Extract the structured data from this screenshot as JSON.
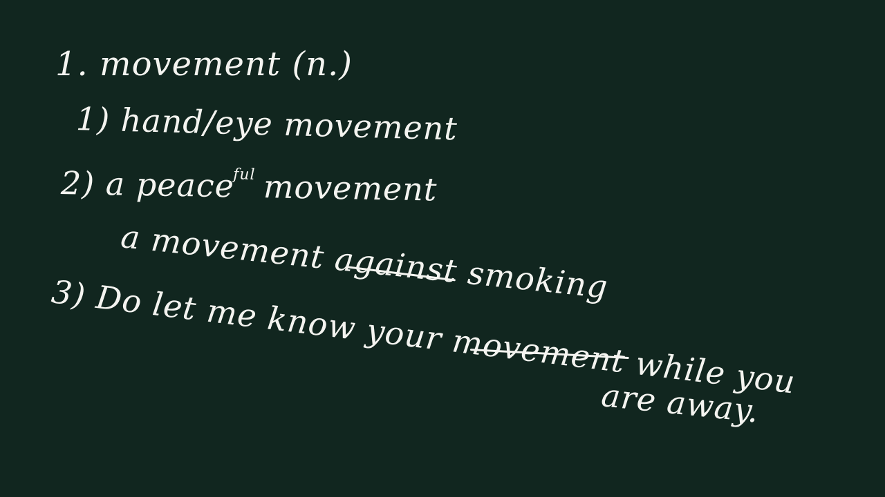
{
  "board": {
    "background_color": "#11261f",
    "ink_color": "#f4f4f0",
    "heading": "1. movement (n.)",
    "example1": "1) hand/eye movement",
    "example2_before": "2) a peace",
    "example2_insert": "ful",
    "example2_after": " movement",
    "example2b_start": "a movement ",
    "example2b_underlined": "against",
    "example2b_end": " smoking",
    "example3_start": "3) Do let me know your ",
    "example3_underlined": "movement",
    "example3_end": " while you",
    "example3_cont": "are away."
  }
}
